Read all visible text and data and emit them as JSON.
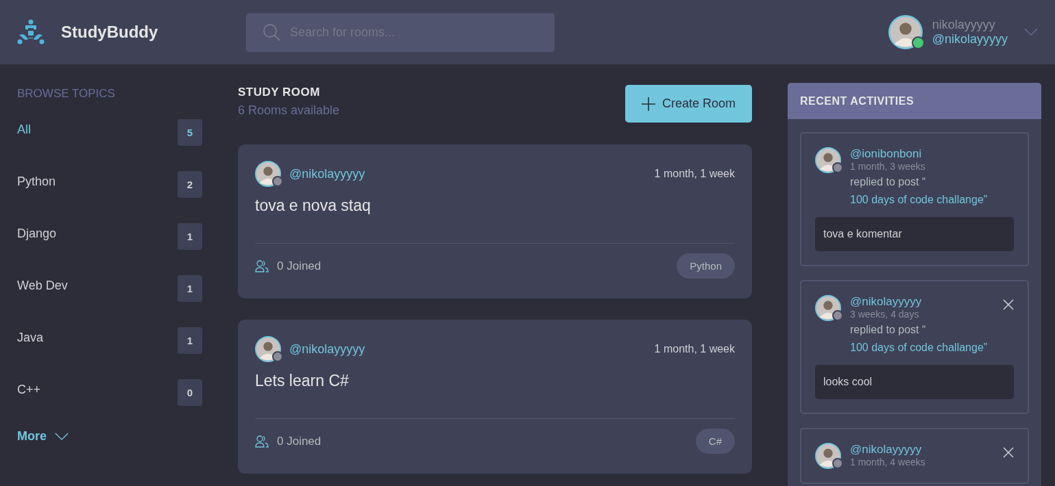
{
  "header": {
    "brand": "StudyBuddy",
    "search": {
      "placeholder": "Search for rooms..."
    },
    "user": {
      "name": "nikolayyyyy",
      "handle": "@nikolayyyyy",
      "online": true
    }
  },
  "sidebar": {
    "title": "BROWSE TOPICS",
    "topics": [
      {
        "label": "All",
        "count": "5",
        "selected": true
      },
      {
        "label": "Python",
        "count": "2",
        "selected": false
      },
      {
        "label": "Django",
        "count": "1",
        "selected": false
      },
      {
        "label": "Web Dev",
        "count": "1",
        "selected": false
      },
      {
        "label": "Java",
        "count": "1",
        "selected": false
      },
      {
        "label": "C++",
        "count": "0",
        "selected": false
      }
    ],
    "more": "More"
  },
  "rooms": {
    "title": "STUDY ROOM",
    "subtitle": "6 Rooms available",
    "create_button": "Create Room",
    "items": [
      {
        "host": "@nikolayyyyy",
        "online": false,
        "time": "1 month, 1 week",
        "name": "tova e nova staq",
        "joined": "0 Joined",
        "topic": "Python"
      },
      {
        "host": "@nikolayyyyy",
        "online": false,
        "time": "1 month, 1 week",
        "name": "Lets learn C#",
        "joined": "0 Joined",
        "topic": "C#"
      }
    ]
  },
  "activities": {
    "title": "RECENT ACTIVITIES",
    "items": [
      {
        "user": "@ionibonboni",
        "online": false,
        "time": "1 month, 3 weeks",
        "action": "replied to post “",
        "post": "100 days of code challange”",
        "comment": "tova e komentar",
        "deletable": false
      },
      {
        "user": "@nikolayyyyy",
        "online": false,
        "time": "3 weeks, 4 days",
        "action": "replied to post “",
        "post": "100 days of code challange”",
        "comment": "looks cool",
        "deletable": true
      },
      {
        "user": "@nikolayyyyy",
        "online": false,
        "time": "1 month, 4 weeks",
        "deletable": true
      }
    ]
  }
}
